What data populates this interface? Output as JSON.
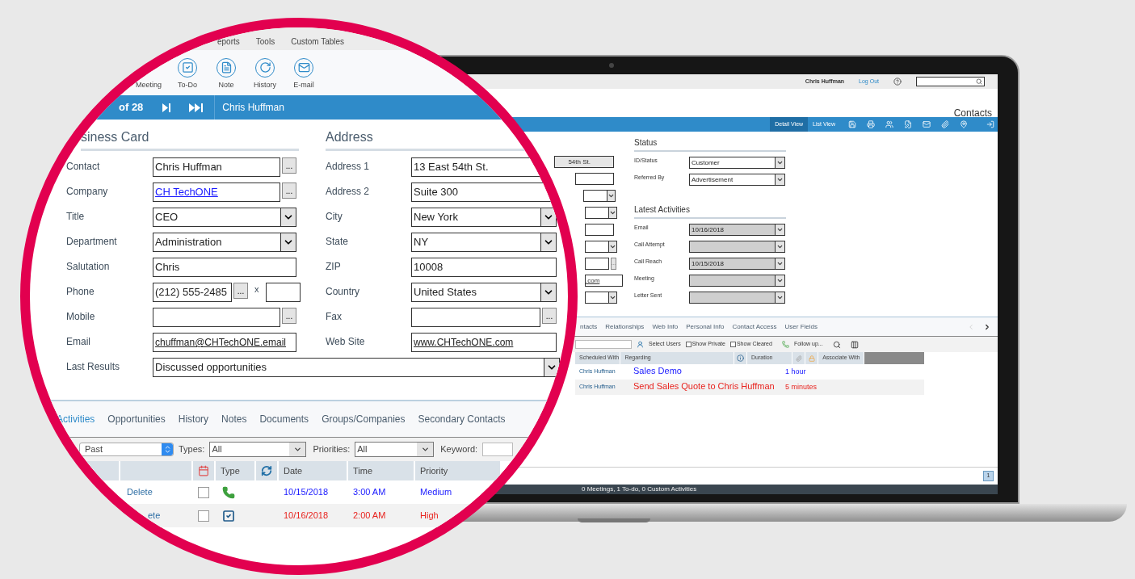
{
  "laptop": {
    "top_bar": {
      "user": "Chris Huffman",
      "logout": "Log Out"
    },
    "page_title": "Contacts",
    "view_tabs": [
      {
        "label": "Detail View",
        "selected": true
      },
      {
        "label": "List View",
        "selected": false
      }
    ],
    "partial_fields": [
      {
        "kind": "input",
        "value": "54th St."
      },
      {
        "kind": "input"
      },
      {
        "kind": "select"
      },
      {
        "kind": "select"
      },
      {
        "kind": "input"
      },
      {
        "kind": "select"
      },
      {
        "kind": "input",
        "button": "..."
      },
      {
        "kind": "input",
        "value": ".com"
      },
      {
        "kind": "select"
      }
    ],
    "status": {
      "heading": "Status",
      "fields": [
        {
          "label": "ID/Status",
          "value": "Customer",
          "disabled": false
        },
        {
          "label": "Referred By",
          "value": "Advertisement",
          "disabled": false
        }
      ]
    },
    "latest_activities": {
      "heading": "Latest Activities",
      "fields": [
        {
          "label": "Email",
          "value": "10/16/2018",
          "disabled": true
        },
        {
          "label": "Call Attempt",
          "disabled": true
        },
        {
          "label": "Call Reach",
          "value": "10/15/2018",
          "disabled": true
        },
        {
          "label": "Meeting",
          "disabled": true
        },
        {
          "label": "Letter Sent",
          "disabled": true
        }
      ]
    },
    "tabs": [
      {
        "label": "ntacts",
        "selected": false
      },
      {
        "label": "Relationships",
        "selected": false
      },
      {
        "label": "Web Info",
        "selected": false
      },
      {
        "label": "Personal Info",
        "selected": false
      },
      {
        "label": "Contact Access",
        "selected": false
      },
      {
        "label": "User Fields",
        "selected": false
      }
    ],
    "toolbar": {
      "select_users": "Select Users",
      "checkboxes": [
        {
          "label": "Show Private",
          "checked": false
        },
        {
          "label": "Show Cleared",
          "checked": false
        }
      ],
      "follow_up": "Follow up..."
    },
    "table": {
      "columns": [
        "Scheduled With",
        "Regarding",
        "Duration",
        "Associate With"
      ],
      "rows": [
        {
          "scheduled_with": "Chris Huffman",
          "regarding": "Sales Demo",
          "duration": "1 hour",
          "color": "#1a1aff"
        },
        {
          "scheduled_with": "Chris Huffman",
          "regarding": "Send Sales Quote to Chris Huffman",
          "duration": "5 minutes",
          "color": "#e8231e"
        }
      ]
    },
    "pagination": [
      {
        "label": "1",
        "selected": true
      }
    ],
    "status_bar": "0 Meetings, 1 To-do, 0 Custom Activities"
  },
  "zoom": {
    "menu": [
      "eports",
      "Tools",
      "Custom Tables"
    ],
    "toolbar": [
      {
        "label": "Meeting",
        "kind": "meeting"
      },
      {
        "label": "To-Do",
        "kind": "todo"
      },
      {
        "label": "Note",
        "kind": "note"
      },
      {
        "label": "History",
        "kind": "history"
      },
      {
        "label": "E-mail",
        "kind": "email"
      }
    ],
    "record_bar": {
      "position": "of 28",
      "contact": "Chris Huffman"
    },
    "business_card": {
      "heading": "siness Card",
      "fields": [
        {
          "label": "Contact",
          "kind": "input",
          "value": "Chris Huffman",
          "button": "..."
        },
        {
          "label": "Company",
          "kind": "link",
          "value": "CH TechONE",
          "button": "..."
        },
        {
          "label": "Title",
          "kind": "select",
          "value": "CEO"
        },
        {
          "label": "Department",
          "kind": "select",
          "value": "Administration"
        },
        {
          "label": "Salutation",
          "kind": "input",
          "value": "Chris"
        },
        {
          "label": "Phone",
          "kind": "phone",
          "value": "(212) 555-2485",
          "button": "...",
          "extension_label": "x"
        },
        {
          "label": "Mobile",
          "kind": "input",
          "button": "..."
        },
        {
          "label": "Email",
          "kind": "underlined",
          "value": "chuffman@CHTechONE.email"
        }
      ]
    },
    "address": {
      "heading": "Address",
      "fields": [
        {
          "label": "Address 1",
          "kind": "input",
          "value": "13 East 54th St."
        },
        {
          "label": "Address 2",
          "kind": "input",
          "value": "Suite 300"
        },
        {
          "label": "City",
          "kind": "select",
          "value": "New York"
        },
        {
          "label": "State",
          "kind": "select",
          "value": "NY"
        },
        {
          "label": "ZIP",
          "kind": "input",
          "value": "10008"
        },
        {
          "label": "Country",
          "kind": "select",
          "value": "United States"
        },
        {
          "label": "Fax",
          "kind": "input",
          "button": "..."
        },
        {
          "label": "Web Site",
          "kind": "underlined",
          "value": "www.CHTechONE.com"
        }
      ]
    },
    "last_results": {
      "label": "Last Results",
      "value": "Discussed opportunities"
    },
    "tabs": [
      {
        "label": "Activities",
        "selected": true
      },
      {
        "label": "Opportunities",
        "selected": false
      },
      {
        "label": "History",
        "selected": false
      },
      {
        "label": "Notes",
        "selected": false
      },
      {
        "label": "Documents",
        "selected": false
      },
      {
        "label": "Groups/Companies",
        "selected": false
      },
      {
        "label": "Secondary Contacts",
        "selected": false
      }
    ],
    "filters": {
      "show": "Past",
      "types_label": "Types:",
      "types": "All",
      "priorities_label": "Priorities:",
      "priorities": "All",
      "keyword_label": "Keyword:"
    },
    "table": {
      "columns": [
        "Type",
        "Date",
        "Time",
        "Priority"
      ],
      "rows": [
        {
          "action": "Delete",
          "checked": false,
          "kind": "call",
          "date": "10/15/2018",
          "time": "3:00 AM",
          "priority": "Medium",
          "color": "#1a1aff"
        },
        {
          "action": "ete",
          "checked": false,
          "kind": "todo",
          "date": "10/16/2018",
          "time": "2:00 AM",
          "priority": "High",
          "color": "#e8231e"
        }
      ]
    }
  }
}
